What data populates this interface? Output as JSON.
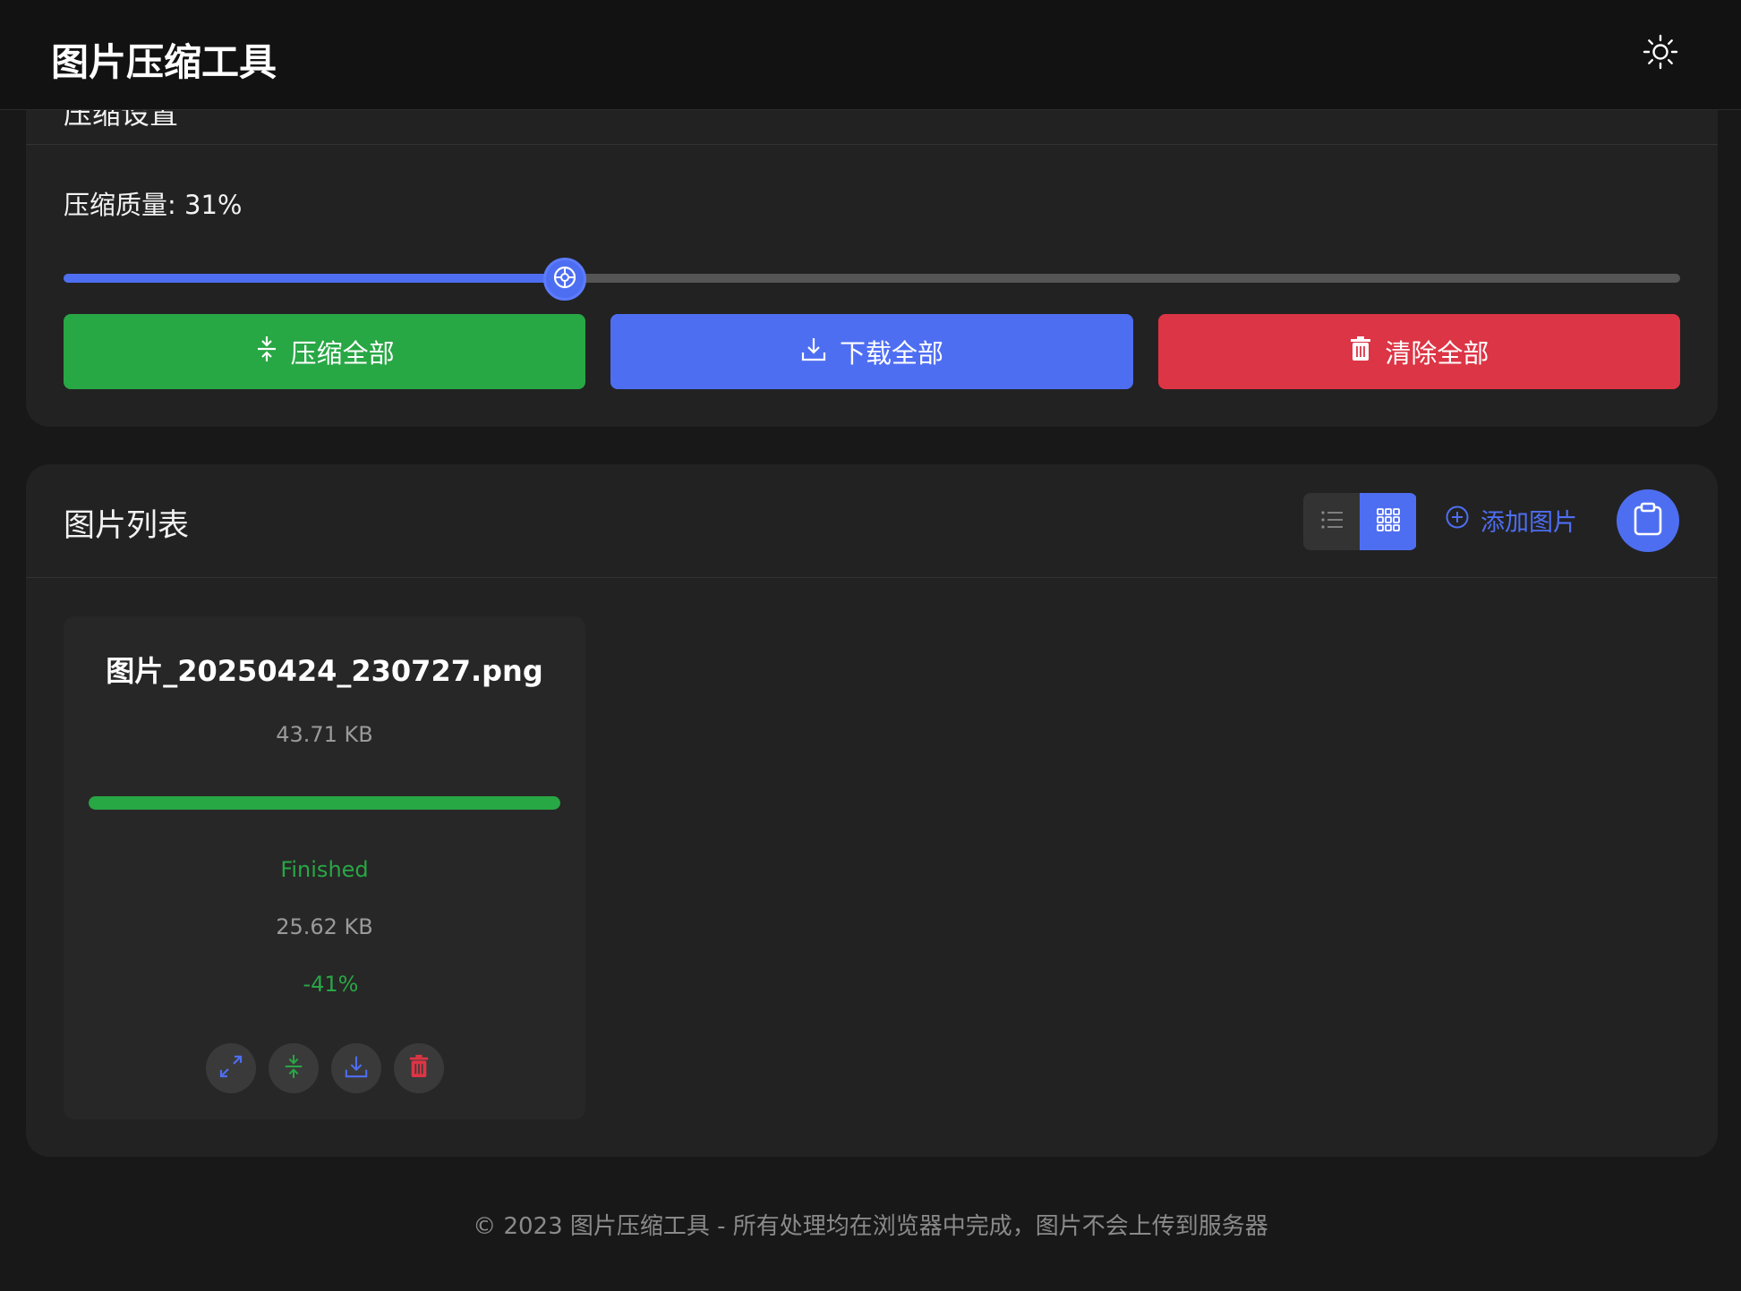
{
  "header": {
    "app_title": "图片压缩工具",
    "theme_icon": "sun-icon"
  },
  "settings": {
    "title": "压缩设置",
    "quality_label": "压缩质量: 31%",
    "quality_value": 31,
    "buttons": {
      "compress_all": "压缩全部",
      "download_all": "下载全部",
      "clear_all": "清除全部"
    }
  },
  "image_list": {
    "title": "图片列表",
    "add_label": "添加图片",
    "active_view": "grid",
    "items": [
      {
        "name": "图片_20250424_230727.png",
        "original_size": "43.71 KB",
        "progress": 1.0,
        "status": "Finished",
        "compressed_size": "25.62 KB",
        "ratio": "-41%"
      }
    ]
  },
  "footer": {
    "text": "© 2023 图片压缩工具 - 所有处理均在浏览器中完成，图片不会上传到服务器"
  },
  "colors": {
    "accent": "#4e6ef2",
    "success": "#28a745",
    "danger": "#dc3545",
    "background": "#181818",
    "card": "#222222"
  }
}
